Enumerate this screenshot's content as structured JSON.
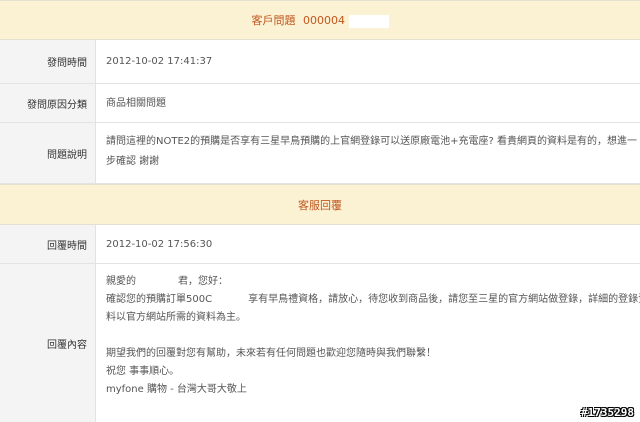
{
  "question_header": {
    "title": "客戶問題",
    "number": "000004"
  },
  "question": {
    "ask_time_label": "發問時間",
    "ask_time_value": "2012-10-02 17:41:37",
    "category_label": "發問原因分類",
    "category_value": "商品相關問題",
    "description_label": "問題說明",
    "description_line1": "請問這裡的NOTE2的預購是否享有三星早鳥預購的上官網登錄可以送原廠電池+充電座? 看貴網頁的資料是有的，想進一",
    "description_line2": "步確認 謝謝"
  },
  "reply_header": {
    "title": "客服回覆"
  },
  "reply": {
    "time_label": "回覆時間",
    "time_value": "2012-10-02 17:56:30",
    "content_label": "回覆內容",
    "greeting_prefix": "親愛的",
    "greeting_suffix": "君，您好：",
    "line_order_prefix": "確認您的預購訂單500C",
    "line_order_suffix": "享有早鳥禮資格，請放心，待您收到商品後，請您至三星的官方網站做登錄，詳細的登錄資",
    "line_official": "料以官方網站所需的資料為主。",
    "line_hope": "期望我們的回覆對您有幫助，未來若有任何問題也歡迎您隨時與我們聯繫！",
    "line_wish": "祝您 事事順心。",
    "signature": "myfone 購物 - 台灣大哥大敬上"
  },
  "watermark": "#1735298"
}
